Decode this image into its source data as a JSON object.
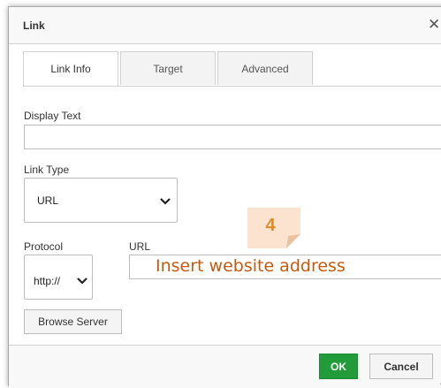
{
  "dialog": {
    "title": "Link",
    "close_glyph": "✕"
  },
  "tabs": [
    {
      "label": "Link Info",
      "active": true
    },
    {
      "label": "Target",
      "active": false
    },
    {
      "label": "Advanced",
      "active": false
    }
  ],
  "form": {
    "display_text_label": "Display Text",
    "display_text_value": "",
    "link_type_label": "Link Type",
    "link_type_value": "URL",
    "protocol_label": "Protocol",
    "protocol_value": "http://",
    "url_label": "URL",
    "url_value": "",
    "browse_label": "Browse Server"
  },
  "annotation": {
    "step_number": "4",
    "hint_text": "Insert website address",
    "colors": {
      "note_bg": "#fbe3cf",
      "note_fold": "#e9c2a2",
      "number": "#e38b26",
      "hint": "#c55a11"
    }
  },
  "footer": {
    "ok_label": "OK",
    "cancel_label": "Cancel"
  },
  "icons": {
    "close": "close-icon",
    "dropdown": "chevron-down-icon",
    "resize": "resize-grip-icon"
  },
  "colors": {
    "ok_green": "#229c3b",
    "border": "#bcbcbc",
    "dialog_bg": "#f8f8f8"
  }
}
